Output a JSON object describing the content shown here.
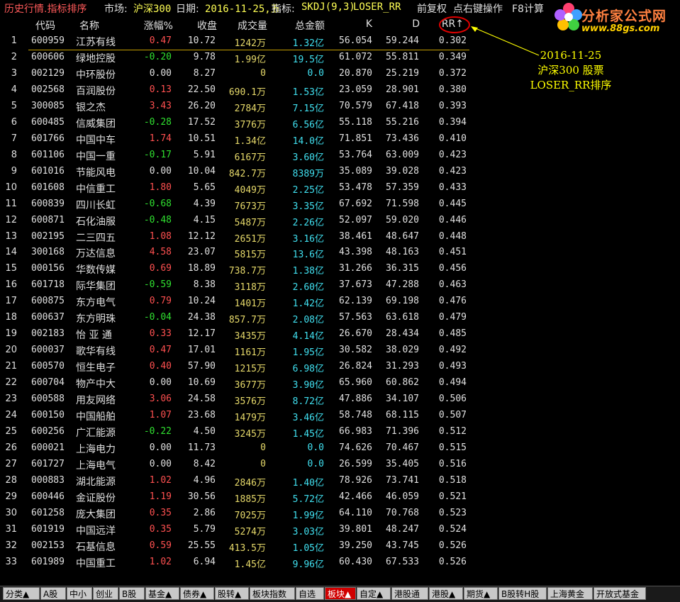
{
  "titlebar": {
    "title": "历史行情.指标排序",
    "market_label": "市场:",
    "market_value": "沪深300",
    "date_label": "日期:",
    "date_value": "2016-11-25,五",
    "indicator_label": "指标:",
    "indicator_value": "SKDJ(9,3)",
    "sort_field": "LOSER_RR",
    "adjust": "前复权",
    "hint": "点右键操作",
    "f8": "F8计算"
  },
  "logo": {
    "brand": "分析家公式网",
    "url": "www.88gs.com"
  },
  "columns": {
    "code": "代码",
    "name": "名称",
    "change": "涨幅%",
    "close": "收盘",
    "volume": "成交量",
    "amount": "总金额",
    "k": "K",
    "d": "D",
    "rr": "RR↑"
  },
  "annotation": {
    "line1": "2016-11-25",
    "line2": "沪深300 股票",
    "line3": "LOSER_RR排序"
  },
  "rows": [
    {
      "no": "1",
      "code": "600959",
      "name": "江苏有线",
      "change": "0.47",
      "close": "10.72",
      "vol_num": "1242",
      "vol_unit": "万",
      "amt_num": "1.32",
      "amt_unit": "亿",
      "k": "56.054",
      "d": "59.244",
      "rr": "0.302",
      "dir": "up"
    },
    {
      "no": "2",
      "code": "600606",
      "name": "绿地控股",
      "change": "-0.20",
      "close": "9.78",
      "vol_num": "1.99",
      "vol_unit": "亿",
      "amt_num": "19.5",
      "amt_unit": "亿",
      "k": "61.072",
      "d": "55.811",
      "rr": "0.349",
      "dir": "down"
    },
    {
      "no": "3",
      "code": "002129",
      "name": "中环股份",
      "change": "0.00",
      "close": "8.27",
      "vol_num": "0",
      "vol_unit": "",
      "amt_num": "0.0",
      "amt_unit": "",
      "k": "20.870",
      "d": "25.219",
      "rr": "0.372",
      "dir": "flat"
    },
    {
      "no": "4",
      "code": "002568",
      "name": "百润股份",
      "change": "0.13",
      "close": "22.50",
      "vol_num": "690.1",
      "vol_unit": "万",
      "amt_num": "1.53",
      "amt_unit": "亿",
      "k": "23.059",
      "d": "28.901",
      "rr": "0.380",
      "dir": "up"
    },
    {
      "no": "5",
      "code": "300085",
      "name": "银之杰",
      "change": "3.43",
      "close": "26.20",
      "vol_num": "2784",
      "vol_unit": "万",
      "amt_num": "7.15",
      "amt_unit": "亿",
      "k": "70.579",
      "d": "67.418",
      "rr": "0.393",
      "dir": "up"
    },
    {
      "no": "6",
      "code": "600485",
      "name": "信威集团",
      "change": "-0.28",
      "close": "17.52",
      "vol_num": "3776",
      "vol_unit": "万",
      "amt_num": "6.56",
      "amt_unit": "亿",
      "k": "55.118",
      "d": "55.216",
      "rr": "0.394",
      "dir": "down"
    },
    {
      "no": "7",
      "code": "601766",
      "name": "中国中车",
      "change": "1.74",
      "close": "10.51",
      "vol_num": "1.34",
      "vol_unit": "亿",
      "amt_num": "14.0",
      "amt_unit": "亿",
      "k": "71.851",
      "d": "73.436",
      "rr": "0.410",
      "dir": "up"
    },
    {
      "no": "8",
      "code": "601106",
      "name": "中国一重",
      "change": "-0.17",
      "close": "5.91",
      "vol_num": "6167",
      "vol_unit": "万",
      "amt_num": "3.60",
      "amt_unit": "亿",
      "k": "53.764",
      "d": "63.009",
      "rr": "0.423",
      "dir": "down"
    },
    {
      "no": "9",
      "code": "601016",
      "name": "节能风电",
      "change": "0.00",
      "close": "10.04",
      "vol_num": "842.7",
      "vol_unit": "万",
      "amt_num": "8389",
      "amt_unit": "万",
      "k": "35.089",
      "d": "39.028",
      "rr": "0.423",
      "dir": "flat"
    },
    {
      "no": "10",
      "code": "601608",
      "name": "中信重工",
      "change": "1.80",
      "close": "5.65",
      "vol_num": "4049",
      "vol_unit": "万",
      "amt_num": "2.25",
      "amt_unit": "亿",
      "k": "53.478",
      "d": "57.359",
      "rr": "0.433",
      "dir": "up"
    },
    {
      "no": "11",
      "code": "600839",
      "name": "四川长虹",
      "change": "-0.68",
      "close": "4.39",
      "vol_num": "7673",
      "vol_unit": "万",
      "amt_num": "3.35",
      "amt_unit": "亿",
      "k": "67.692",
      "d": "71.598",
      "rr": "0.445",
      "dir": "down"
    },
    {
      "no": "12",
      "code": "600871",
      "name": "石化油服",
      "change": "-0.48",
      "close": "4.15",
      "vol_num": "5487",
      "vol_unit": "万",
      "amt_num": "2.26",
      "amt_unit": "亿",
      "k": "52.097",
      "d": "59.020",
      "rr": "0.446",
      "dir": "down"
    },
    {
      "no": "13",
      "code": "002195",
      "name": "二三四五",
      "change": "1.08",
      "close": "12.12",
      "vol_num": "2651",
      "vol_unit": "万",
      "amt_num": "3.16",
      "amt_unit": "亿",
      "k": "38.461",
      "d": "48.647",
      "rr": "0.448",
      "dir": "up"
    },
    {
      "no": "14",
      "code": "300168",
      "name": "万达信息",
      "change": "4.58",
      "close": "23.07",
      "vol_num": "5815",
      "vol_unit": "万",
      "amt_num": "13.6",
      "amt_unit": "亿",
      "k": "43.398",
      "d": "48.163",
      "rr": "0.451",
      "dir": "up"
    },
    {
      "no": "15",
      "code": "000156",
      "name": "华数传媒",
      "change": "0.69",
      "close": "18.89",
      "vol_num": "738.7",
      "vol_unit": "万",
      "amt_num": "1.38",
      "amt_unit": "亿",
      "k": "31.266",
      "d": "36.315",
      "rr": "0.456",
      "dir": "up"
    },
    {
      "no": "16",
      "code": "601718",
      "name": "际华集团",
      "change": "-0.59",
      "close": "8.38",
      "vol_num": "3118",
      "vol_unit": "万",
      "amt_num": "2.60",
      "amt_unit": "亿",
      "k": "37.673",
      "d": "47.288",
      "rr": "0.463",
      "dir": "down"
    },
    {
      "no": "17",
      "code": "600875",
      "name": "东方电气",
      "change": "0.79",
      "close": "10.24",
      "vol_num": "1401",
      "vol_unit": "万",
      "amt_num": "1.42",
      "amt_unit": "亿",
      "k": "62.139",
      "d": "69.198",
      "rr": "0.476",
      "dir": "up"
    },
    {
      "no": "18",
      "code": "600637",
      "name": "东方明珠",
      "change": "-0.04",
      "close": "24.38",
      "vol_num": "857.7",
      "vol_unit": "万",
      "amt_num": "2.08",
      "amt_unit": "亿",
      "k": "57.563",
      "d": "63.618",
      "rr": "0.479",
      "dir": "down"
    },
    {
      "no": "19",
      "code": "002183",
      "name": "怡 亚 通",
      "change": "0.33",
      "close": "12.17",
      "vol_num": "3435",
      "vol_unit": "万",
      "amt_num": "4.14",
      "amt_unit": "亿",
      "k": "26.670",
      "d": "28.434",
      "rr": "0.485",
      "dir": "up"
    },
    {
      "no": "20",
      "code": "600037",
      "name": "歌华有线",
      "change": "0.47",
      "close": "17.01",
      "vol_num": "1161",
      "vol_unit": "万",
      "amt_num": "1.95",
      "amt_unit": "亿",
      "k": "30.582",
      "d": "38.029",
      "rr": "0.492",
      "dir": "up"
    },
    {
      "no": "21",
      "code": "600570",
      "name": "恒生电子",
      "change": "0.40",
      "close": "57.90",
      "vol_num": "1215",
      "vol_unit": "万",
      "amt_num": "6.98",
      "amt_unit": "亿",
      "k": "26.824",
      "d": "31.293",
      "rr": "0.493",
      "dir": "up"
    },
    {
      "no": "22",
      "code": "600704",
      "name": "物产中大",
      "change": "0.00",
      "close": "10.69",
      "vol_num": "3677",
      "vol_unit": "万",
      "amt_num": "3.90",
      "amt_unit": "亿",
      "k": "65.960",
      "d": "60.862",
      "rr": "0.494",
      "dir": "flat"
    },
    {
      "no": "23",
      "code": "600588",
      "name": "用友网络",
      "change": "3.06",
      "close": "24.58",
      "vol_num": "3576",
      "vol_unit": "万",
      "amt_num": "8.72",
      "amt_unit": "亿",
      "k": "47.886",
      "d": "34.107",
      "rr": "0.506",
      "dir": "up"
    },
    {
      "no": "24",
      "code": "600150",
      "name": "中国船舶",
      "change": "1.07",
      "close": "23.68",
      "vol_num": "1479",
      "vol_unit": "万",
      "amt_num": "3.46",
      "amt_unit": "亿",
      "k": "58.748",
      "d": "68.115",
      "rr": "0.507",
      "dir": "up"
    },
    {
      "no": "25",
      "code": "600256",
      "name": "广汇能源",
      "change": "-0.22",
      "close": "4.50",
      "vol_num": "3245",
      "vol_unit": "万",
      "amt_num": "1.45",
      "amt_unit": "亿",
      "k": "66.983",
      "d": "71.396",
      "rr": "0.512",
      "dir": "down"
    },
    {
      "no": "26",
      "code": "600021",
      "name": "上海电力",
      "change": "0.00",
      "close": "11.73",
      "vol_num": "0",
      "vol_unit": "",
      "amt_num": "0.0",
      "amt_unit": "",
      "k": "74.626",
      "d": "70.467",
      "rr": "0.515",
      "dir": "flat"
    },
    {
      "no": "27",
      "code": "601727",
      "name": "上海电气",
      "change": "0.00",
      "close": "8.42",
      "vol_num": "0",
      "vol_unit": "",
      "amt_num": "0.0",
      "amt_unit": "",
      "k": "26.599",
      "d": "35.405",
      "rr": "0.516",
      "dir": "flat"
    },
    {
      "no": "28",
      "code": "000883",
      "name": "湖北能源",
      "change": "1.02",
      "close": "4.96",
      "vol_num": "2846",
      "vol_unit": "万",
      "amt_num": "1.40",
      "amt_unit": "亿",
      "k": "78.926",
      "d": "73.741",
      "rr": "0.518",
      "dir": "up"
    },
    {
      "no": "29",
      "code": "600446",
      "name": "金证股份",
      "change": "1.19",
      "close": "30.56",
      "vol_num": "1885",
      "vol_unit": "万",
      "amt_num": "5.72",
      "amt_unit": "亿",
      "k": "42.466",
      "d": "46.059",
      "rr": "0.521",
      "dir": "up"
    },
    {
      "no": "30",
      "code": "601258",
      "name": "庞大集团",
      "change": "0.35",
      "close": "2.86",
      "vol_num": "7025",
      "vol_unit": "万",
      "amt_num": "1.99",
      "amt_unit": "亿",
      "k": "64.110",
      "d": "70.768",
      "rr": "0.523",
      "dir": "up"
    },
    {
      "no": "31",
      "code": "601919",
      "name": "中国远洋",
      "change": "0.35",
      "close": "5.79",
      "vol_num": "5274",
      "vol_unit": "万",
      "amt_num": "3.03",
      "amt_unit": "亿",
      "k": "39.801",
      "d": "48.247",
      "rr": "0.524",
      "dir": "up"
    },
    {
      "no": "32",
      "code": "002153",
      "name": "石基信息",
      "change": "0.59",
      "close": "25.55",
      "vol_num": "413.5",
      "vol_unit": "万",
      "amt_num": "1.05",
      "amt_unit": "亿",
      "k": "39.250",
      "d": "43.745",
      "rr": "0.526",
      "dir": "up"
    },
    {
      "no": "33",
      "code": "601989",
      "name": "中国重工",
      "change": "1.02",
      "close": "6.94",
      "vol_num": "1.45",
      "vol_unit": "亿",
      "amt_num": "9.96",
      "amt_unit": "亿",
      "k": "60.430",
      "d": "67.533",
      "rr": "0.526",
      "dir": "up"
    }
  ],
  "tabs": [
    {
      "label": "分类▲",
      "active": false
    },
    {
      "label": "A股",
      "active": false
    },
    {
      "label": "中小",
      "active": false
    },
    {
      "label": "创业",
      "active": false
    },
    {
      "label": "B股",
      "active": false
    },
    {
      "label": "基金▲",
      "active": false
    },
    {
      "label": "债券▲",
      "active": false
    },
    {
      "label": "股转▲",
      "active": false
    },
    {
      "label": "板块指数",
      "active": false
    },
    {
      "label": "自选",
      "active": false
    },
    {
      "label": "板块▲",
      "active": true
    },
    {
      "label": "自定▲",
      "active": false
    },
    {
      "label": "港股通",
      "active": false
    },
    {
      "label": "港股▲",
      "active": false
    },
    {
      "label": "期货▲",
      "active": false
    },
    {
      "label": "B股转H股",
      "active": false
    },
    {
      "label": "上海黄金",
      "active": false
    },
    {
      "label": "开放式基金",
      "active": false
    }
  ],
  "colors": {
    "up": "#ff5050",
    "down": "#30e030",
    "flat": "#e0e0e0",
    "volume": "#e6d96a",
    "amount": "#40e0f0",
    "active_tab": "#d00000"
  }
}
